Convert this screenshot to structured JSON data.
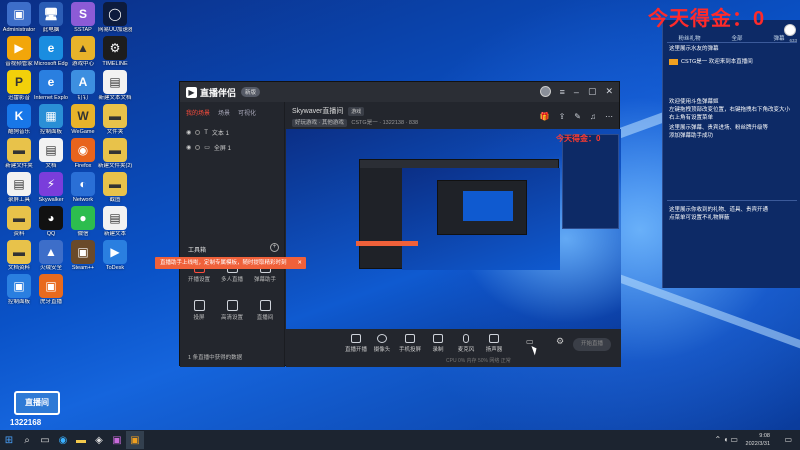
{
  "desktop": {
    "icons": [
      {
        "label": "Administrator",
        "glyph": "▣",
        "bg": "#3d6ec9"
      },
      {
        "label": "此电脑",
        "glyph": "🖥",
        "bg": "#2b5db5"
      },
      {
        "label": "SSTAP",
        "glyph": "S",
        "bg": "#8c5bd6"
      },
      {
        "label": "网易UU加速器",
        "glyph": "◯",
        "bg": "#0d1b3d"
      },
      {
        "label": "音视频管家",
        "glyph": "▶",
        "bg": "#f2a60a"
      },
      {
        "label": "Microsoft Edge",
        "glyph": "e",
        "bg": "#1a8de0"
      },
      {
        "label": "游戏中心",
        "glyph": "▲",
        "bg": "#e8b32a"
      },
      {
        "label": "TIMELINE",
        "glyph": "⚙",
        "bg": "#1d1d1d"
      },
      {
        "label": "迅雷影音",
        "glyph": "P",
        "bg": "#f2d00a"
      },
      {
        "label": "Internet Explorer",
        "glyph": "e",
        "bg": "#2a7fe0"
      },
      {
        "label": "钉钉",
        "glyph": "A",
        "bg": "#3d8fe0"
      },
      {
        "label": "新建文本文档",
        "glyph": "▤",
        "bg": "#f2f2f2"
      },
      {
        "label": "酷狗音乐",
        "glyph": "K",
        "bg": "#1877e8"
      },
      {
        "label": "控制面板",
        "glyph": "▦",
        "bg": "#2a8fd6"
      },
      {
        "label": "WeGame",
        "glyph": "W",
        "bg": "#e8b32a"
      },
      {
        "label": "文件夹",
        "glyph": "▬",
        "bg": "#e8c24a"
      },
      {
        "label": "新建文件夹",
        "glyph": "▬",
        "bg": "#e8c24a"
      },
      {
        "label": "文档",
        "glyph": "▤",
        "bg": "#f2f2f2"
      },
      {
        "label": "Firefox",
        "glyph": "◉",
        "bg": "#e8641d"
      },
      {
        "label": "新建文件夹(2)",
        "glyph": "▬",
        "bg": "#e8c24a"
      },
      {
        "label": "录屏工具",
        "glyph": "▤",
        "bg": "#f2f2f2"
      },
      {
        "label": "Skywalker",
        "glyph": "⚡",
        "bg": "#7a3ddb"
      },
      {
        "label": "Network",
        "glyph": "◐",
        "bg": "#2a6fd6"
      },
      {
        "label": "截图",
        "glyph": "▬",
        "bg": "#e8c24a"
      },
      {
        "label": "资料",
        "glyph": "▬",
        "bg": "#e8c24a"
      },
      {
        "label": "QQ",
        "glyph": "◕",
        "bg": "#111111"
      },
      {
        "label": "微信",
        "glyph": "●",
        "bg": "#2dbd4e"
      },
      {
        "label": "新建文本",
        "glyph": "▤",
        "bg": "#f2f2f2"
      },
      {
        "label": "文档资料",
        "glyph": "▬",
        "bg": "#e8c24a"
      },
      {
        "label": "火绒安全",
        "glyph": "▲",
        "bg": "#3d6ec9"
      },
      {
        "label": "Steam++",
        "glyph": "▣",
        "bg": "#6a4a2a"
      },
      {
        "label": "ToDesk",
        "glyph": "▶",
        "bg": "#2a7fe0"
      },
      {
        "label": "控制面板",
        "glyph": "▣",
        "bg": "#2a7fe0"
      },
      {
        "label": "虎牙直播",
        "glyph": "▣",
        "bg": "#e86a1d"
      }
    ]
  },
  "window": {
    "app_name": "直播伴侣",
    "version_badge": "新版",
    "sidebar_tabs": [
      "我的场景",
      "场景",
      "可视化"
    ],
    "scene_items": [
      "文本 1",
      "全屏 1"
    ],
    "toolbox_title": "工具箱",
    "tools": [
      "开播设置",
      "多人直播",
      "弹幕助手",
      "投屏",
      "高清设置",
      "直播间"
    ],
    "side_footer": "1 条直播中获得的数据",
    "room_title": "Skywaver直播间",
    "room_tag": "游戏",
    "room_sub_chip": "好玩游戏 · 其他游戏",
    "room_sub_text": "CSTG是一 · 1322138 · 838",
    "bottom_items": [
      "直播开播",
      "摄像头",
      "手机投屏",
      "录制",
      "麦克风",
      "扬声器"
    ],
    "start_button": "开始直播",
    "status_line": "CPU 0%   内存 50%   网络 正常",
    "toast": "直播助手上线啦，定制专属模板，随时提取精彩时刻",
    "toast_close": "✕"
  },
  "overlay": {
    "score": "今天得金：0",
    "tabs": [
      "粉丝礼物",
      "全部",
      "弹幕"
    ],
    "lines": [
      "这里展示水友的弹幕",
      "CSTG是一  欢迎来到本直播间",
      "欢迎使用斗鱼弹幕姬",
      "左键拖拽顶部改变位置，右键拖拽右下角改变大小",
      "右上角有设置菜单",
      "这里展示弹幕、贵宾进场、粉丝牌升级等",
      "添加弹幕助手成功",
      "这里展示你收到的礼物、道具、贵宾开通",
      "点菜单可设置不礼物屏蔽"
    ],
    "mini_count": "633",
    "id_badge": "直播间",
    "id_number": "1322168"
  },
  "taskbar": {
    "start": "⊞",
    "search": "⌕",
    "apps": [
      "▭",
      "◉",
      "▬",
      "◈",
      "▣",
      "▣"
    ],
    "time": "9:08",
    "date": "2022/3/31",
    "tray": "⌃ ◖ ▭"
  },
  "colors": {
    "accent_red": "#ff2a2a",
    "toast_orange": "#f0613a",
    "panel_blue": "#0d2a66"
  }
}
